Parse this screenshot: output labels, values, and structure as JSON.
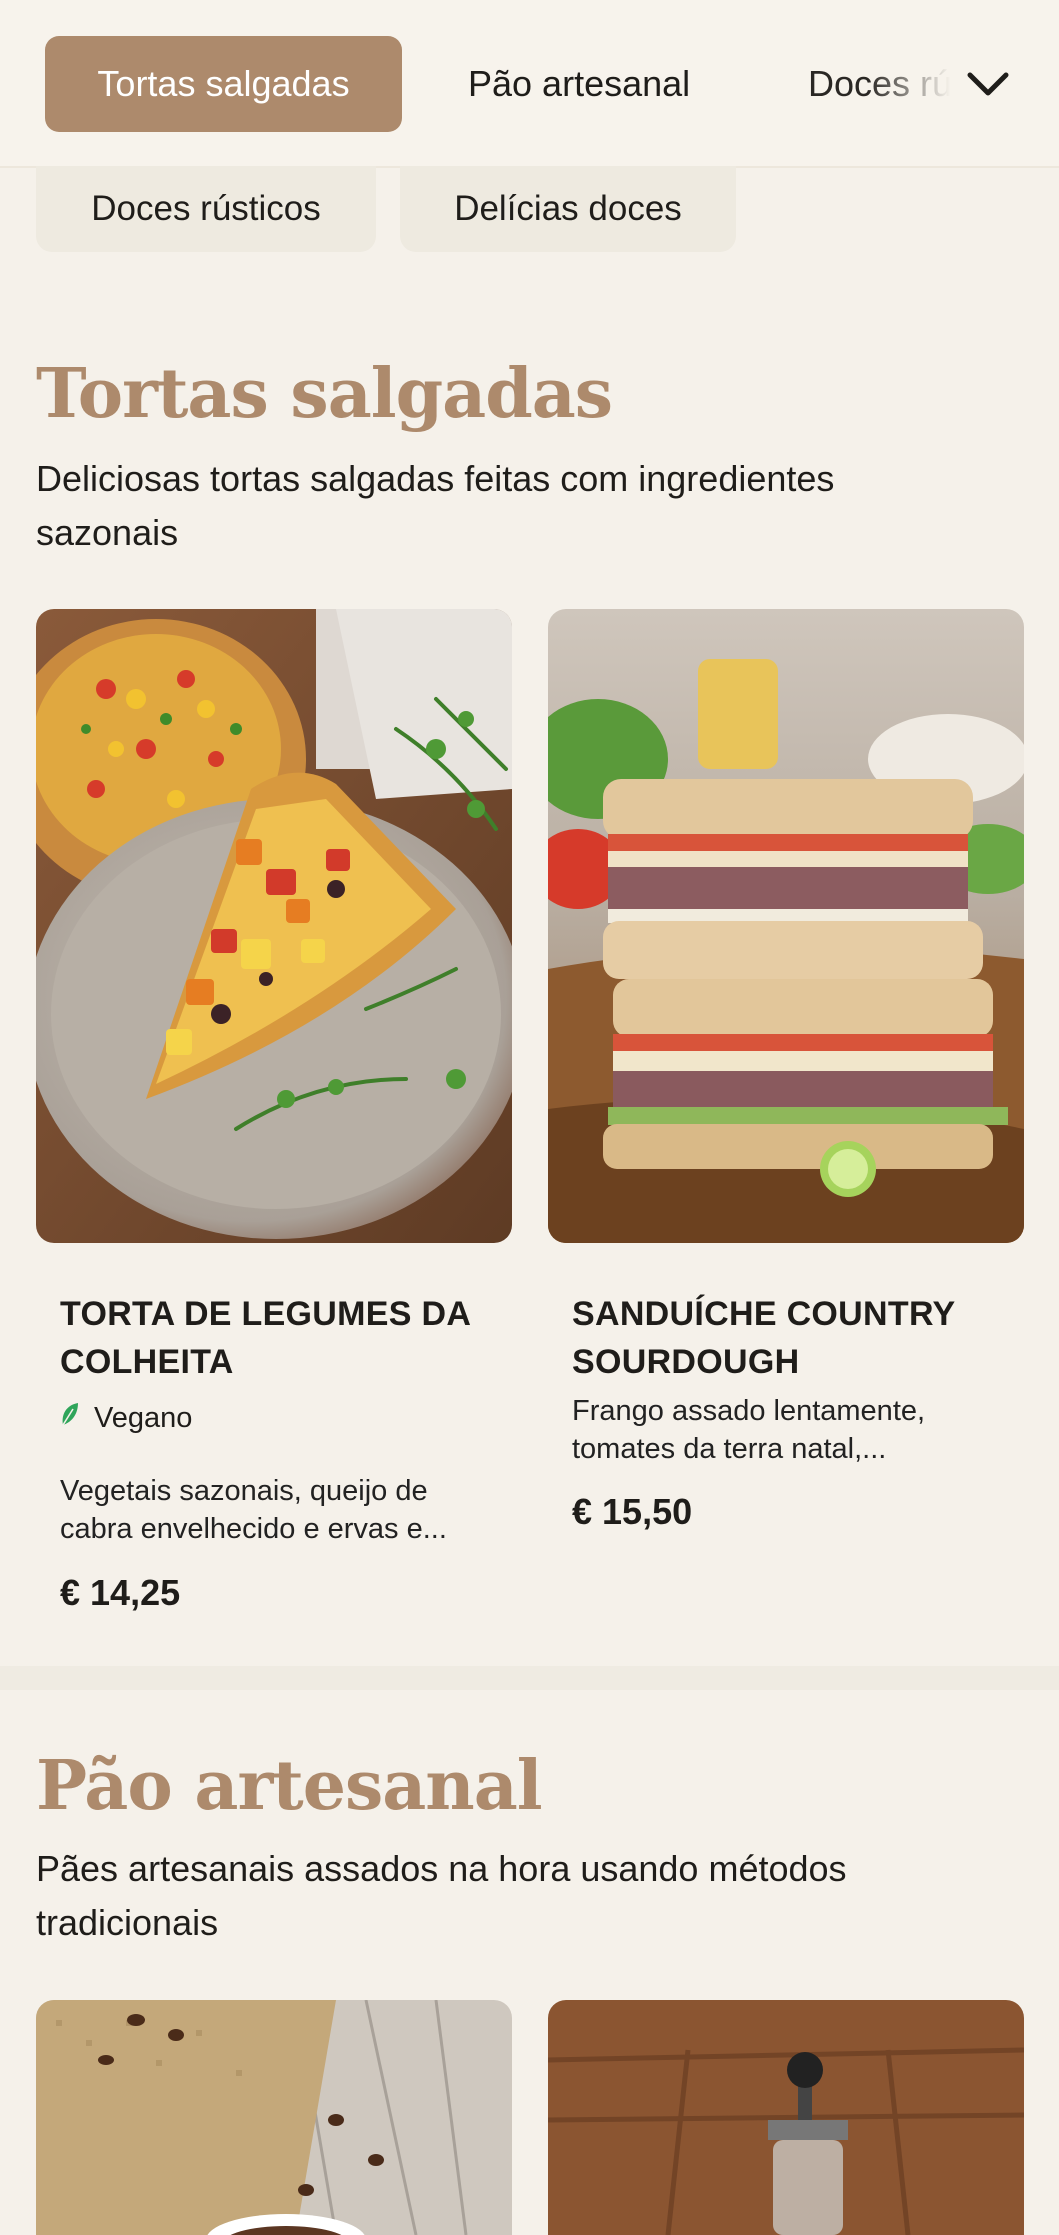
{
  "category_bar": {
    "active": "Tortas salgadas",
    "tabs": [
      "Pão artesanal",
      "Doces rústicos"
    ],
    "chips": [
      "Doces rústicos",
      "Delícias doces"
    ],
    "expand_icon": "chevron-down-icon"
  },
  "sections": [
    {
      "title": "Tortas salgadas",
      "description": "Deliciosas tortas salgadas feitas com ingredientes sazonais",
      "items": [
        {
          "name": "TORTA DE LEGUMES DA COLHEITA",
          "tag": "Vegano",
          "tag_icon": "leaf-icon",
          "description": "Vegetais sazonais, queijo de cabra envelhecido e ervas e...",
          "price": "€ 14,25"
        },
        {
          "name": "SANDUÍCHE COUNTRY SOURDOUGH",
          "description": "Frango assado lentamente, tomates da terra natal,...",
          "price": "€ 15,50"
        }
      ]
    },
    {
      "title": "Pão artesanal",
      "description": "Pães artesanais assados na hora usando métodos tradicionais"
    }
  ],
  "colors": {
    "accent": "#ad8a6c",
    "background": "#f5f1ea",
    "chip": "#eeeae0",
    "vegan_leaf": "#2fa55a"
  }
}
